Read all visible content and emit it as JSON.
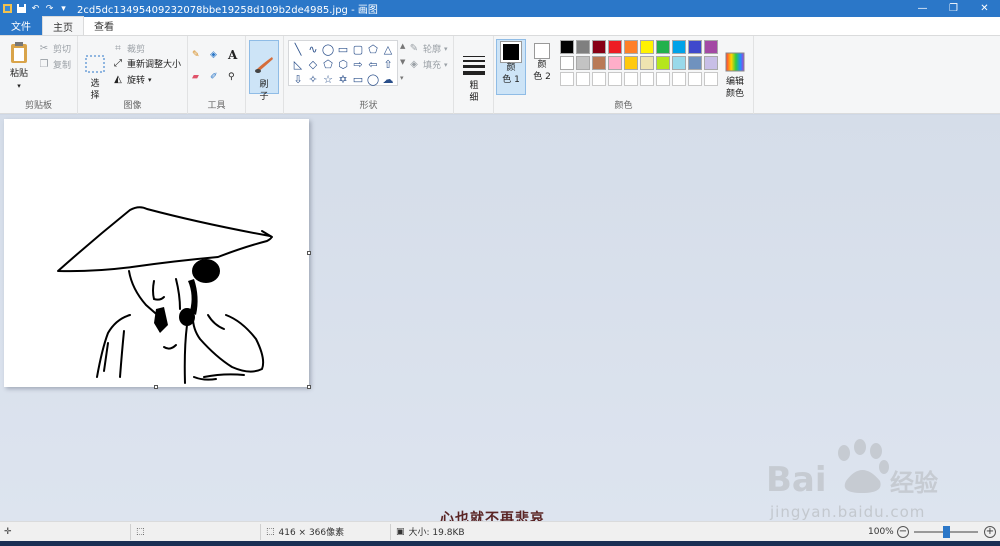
{
  "titlebar": {
    "title": "2cd5dc13495409232078bbe19258d109b2de4985.jpg - 画图",
    "minimize_icon": "minimize-icon",
    "restore_icon": "restore-icon",
    "close_icon": "close-icon"
  },
  "tabs": {
    "file": "文件",
    "home": "主页",
    "view": "查看"
  },
  "ribbon": {
    "clipboard": {
      "label": "剪贴板",
      "paste": "粘贴",
      "cut": "剪切",
      "copy": "复制"
    },
    "image": {
      "label": "图像",
      "select": "选\n择",
      "crop": "裁剪",
      "resize": "重新调整大小",
      "rotate": "旋转"
    },
    "tools": {
      "label": "工具"
    },
    "brush": {
      "label": "刷\n子"
    },
    "shapes": {
      "label": "形状",
      "outline": "轮廓",
      "fill": "填充"
    },
    "size": {
      "label": "粗\n细"
    },
    "colors": {
      "label": "颜色",
      "color1": "颜\n色 1",
      "color2": "颜\n色 2",
      "edit": "编辑\n颜色",
      "palette_row1": [
        "#000000",
        "#7f7f7f",
        "#880015",
        "#ed1c24",
        "#ff7f27",
        "#fff200",
        "#22b14c",
        "#00a2e8",
        "#3f48cc",
        "#a349a4"
      ],
      "palette_row2": [
        "#ffffff",
        "#c3c3c3",
        "#b97a57",
        "#ffaec9",
        "#ffc90e",
        "#efe4b0",
        "#b5e61d",
        "#99d9ea",
        "#7092be",
        "#c8bfe7"
      ],
      "palette_row3": [
        "#ffffff",
        "#ffffff",
        "#ffffff",
        "#ffffff",
        "#ffffff",
        "#ffffff",
        "#ffffff",
        "#ffffff",
        "#ffffff",
        "#ffffff"
      ]
    }
  },
  "status": {
    "dimensions": "416 × 366像素",
    "size": "大小: 19.8KB",
    "zoom": "100%"
  },
  "overlay": {
    "caption": "心也就不再悲哀",
    "watermark_text": "jingyan.baidu.com",
    "watermark_logo": "Bai du 经验"
  }
}
